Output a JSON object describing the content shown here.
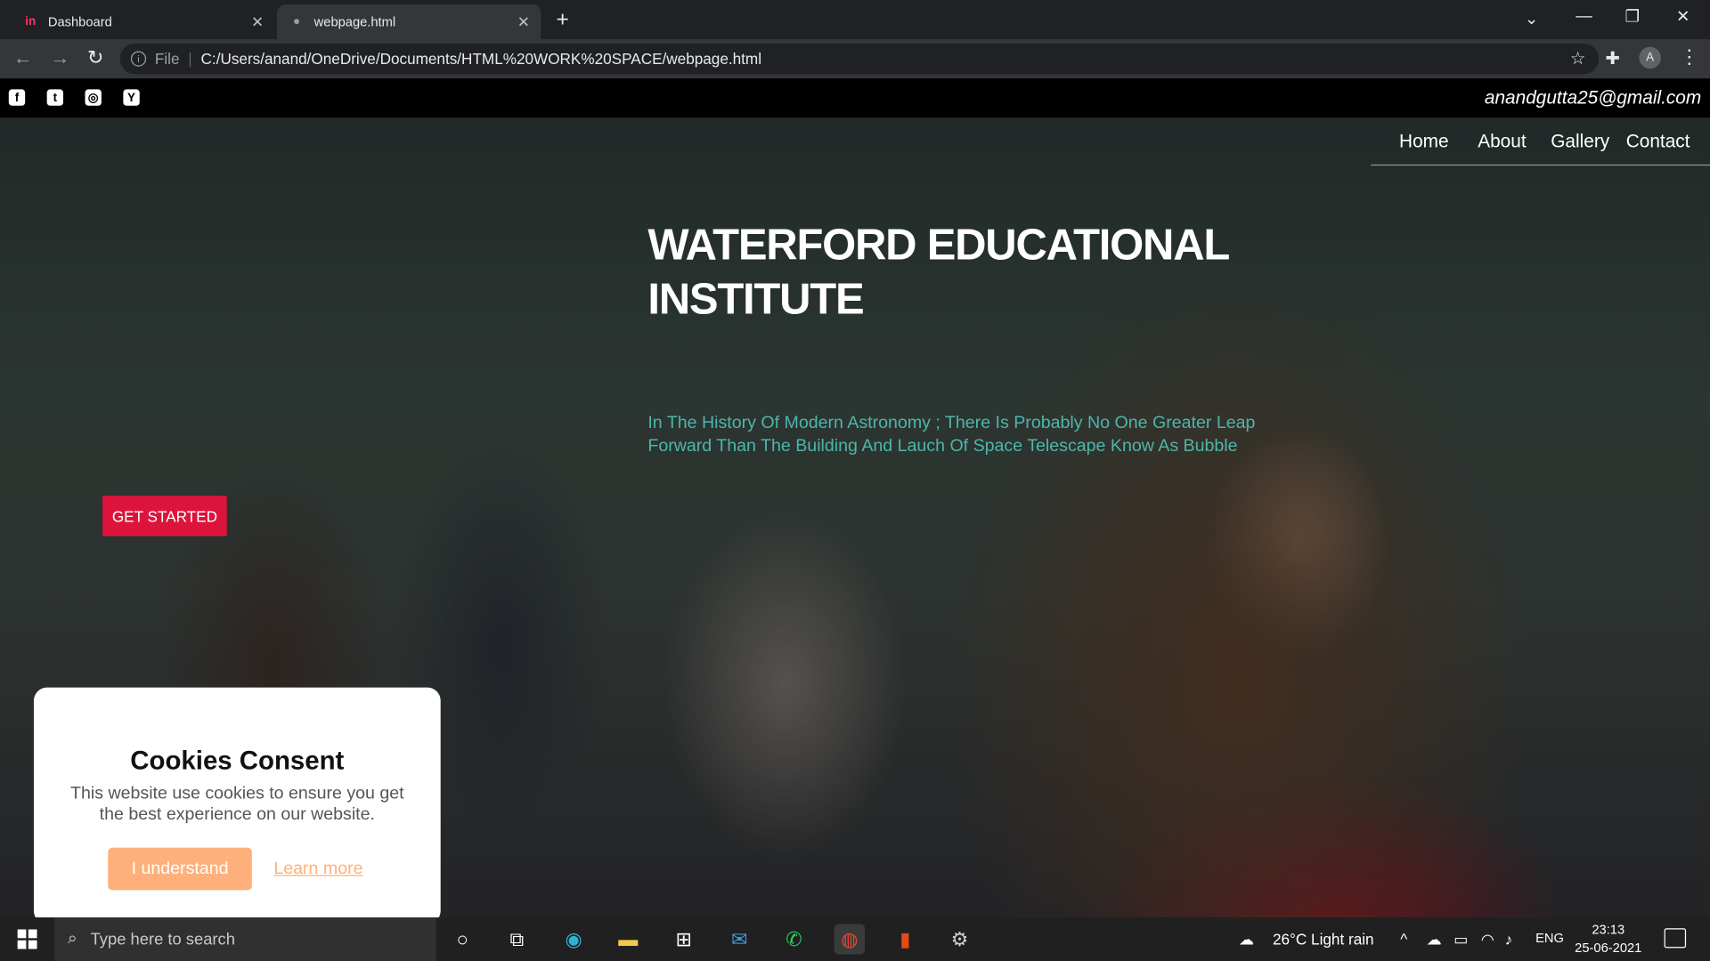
{
  "browser": {
    "tabs": [
      {
        "title": "Dashboard",
        "icon": "in"
      },
      {
        "title": "webpage.html"
      }
    ],
    "address": {
      "scheme": "File",
      "url": "C:/Users/anand/OneDrive/Documents/HTML%20WORK%20SPACE/webpage.html"
    },
    "profile_initial": "A"
  },
  "site": {
    "email": "anandgutta25@gmail.com",
    "social_icons": [
      "facebook-icon",
      "twitter-icon",
      "instagram-icon",
      "ycombinator-icon"
    ],
    "social_glyphs": [
      "f",
      "t",
      "◎",
      "Y"
    ],
    "nav": [
      "Home",
      "About",
      "Gallery",
      "Contact"
    ],
    "title": "WATERFORD EDUCATIONAL INSTITUTE",
    "tagline": "In The History Of Modern Astronomy ; There Is Probably No One Greater Leap Forward Than The Building And Lauch Of Space Telescape Know As Bubble",
    "cta": "GET STARTED",
    "accent": "#dc143c",
    "tagline_color": "#4db6ac"
  },
  "cookie": {
    "title": "Cookies Consent",
    "text": "This website use cookies to ensure you get the best experience on our website.",
    "accept": "I understand",
    "learn_more": "Learn more",
    "button_color": "#ffb07a"
  },
  "taskbar": {
    "search_placeholder": "Type here to search",
    "weather": "26°C  Light rain",
    "lang": "ENG",
    "time": "23:13",
    "date": "25-06-2021"
  }
}
